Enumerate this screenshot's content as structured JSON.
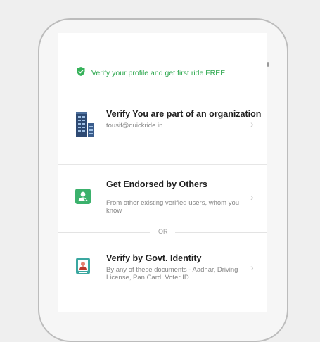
{
  "banner": {
    "text": "Verify your profile and get first ride FREE",
    "icon": "shield-check-icon",
    "color": "#2ea84f"
  },
  "options": [
    {
      "title": "Verify You are part of an organization",
      "subtitle": "tousif@quickride.in",
      "icon": "building-icon"
    },
    {
      "title": "Get Endorsed by Others",
      "subtitle": "From other existing verified users, whom you know",
      "icon": "endorse-user-icon"
    },
    {
      "title": "Verify by Govt. Identity",
      "subtitle": "By any of these documents - Aadhar, Driving License, Pan Card, Voter ID",
      "icon": "id-card-icon"
    }
  ],
  "separator": "OR",
  "chevron_icon": "chevron-right-icon"
}
